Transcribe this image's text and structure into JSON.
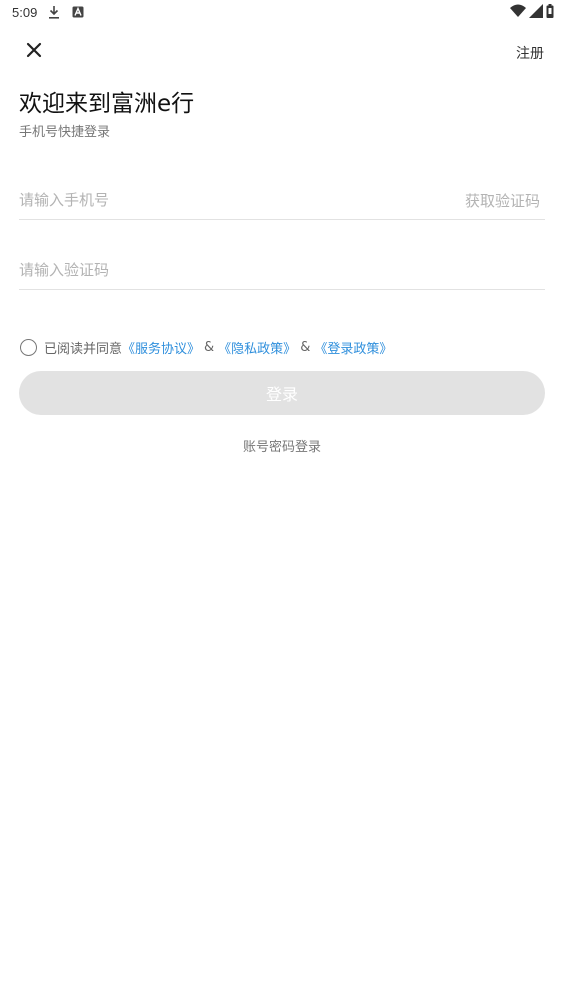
{
  "status_bar": {
    "time": "5:09",
    "icons": [
      "download-icon",
      "notification-a-icon",
      "wifi-icon",
      "signal-icon",
      "battery-icon"
    ]
  },
  "header": {
    "close_icon": "close-icon",
    "register_label": "注册"
  },
  "welcome": {
    "title": "欢迎来到富洲e行",
    "subtitle": "手机号快捷登录"
  },
  "form": {
    "phone_placeholder": "请输入手机号",
    "get_code_label": "获取验证码",
    "code_placeholder": "请输入验证码"
  },
  "agreement": {
    "prefix": "已阅读并同意",
    "service": "《服务协议》",
    "privacy": "《隐私政策》",
    "login_policy": "《登录政策》",
    "amp": "&"
  },
  "login_button_label": "登录",
  "password_login_label": "账号密码登录",
  "colors": {
    "link": "#2f8fdc",
    "button_disabled": "#e2e2e2"
  }
}
